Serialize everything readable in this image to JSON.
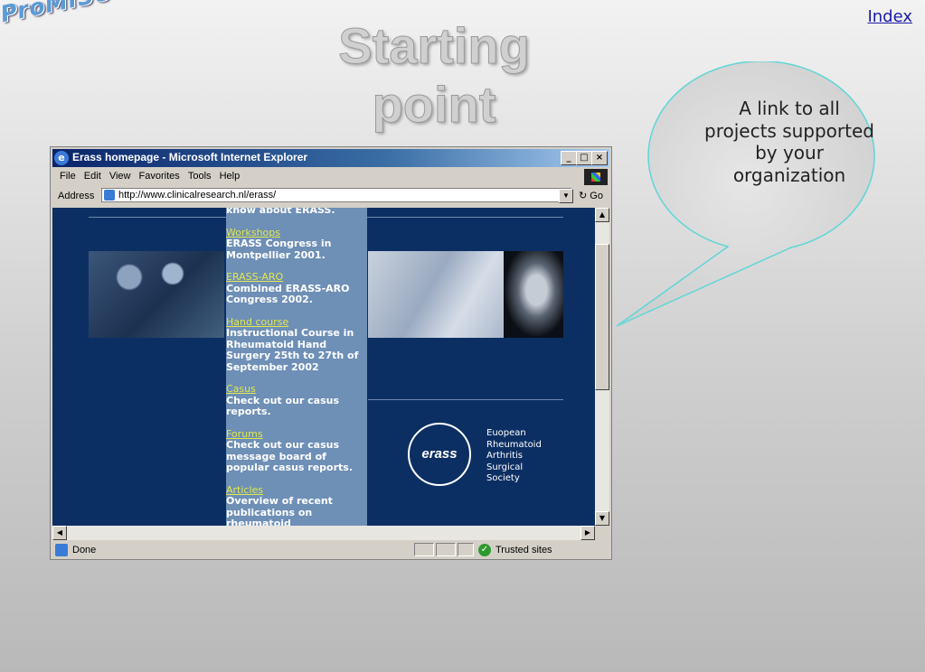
{
  "slide": {
    "logo": "ProMISe",
    "title": "Starting point",
    "index_link": "Index",
    "callout": "A link to all projects supported by your organization"
  },
  "browser": {
    "title": "Erass homepage - Microsoft Internet Explorer",
    "menu": [
      "File",
      "Edit",
      "View",
      "Favorites",
      "Tools",
      "Help"
    ],
    "address_label": "Address",
    "url": "http://www.clinicalresearch.nl/erass/",
    "go_label": "Go",
    "status": "Done",
    "zone": "Trusted sites"
  },
  "page": {
    "intro_tail": "know about ERASS.",
    "links": [
      {
        "label": "Workshops",
        "desc": "ERASS Congress in Montpellier 2001."
      },
      {
        "label": "ERASS-ARO",
        "desc": "Combined ERASS-ARO Congress 2002."
      },
      {
        "label": "Hand course",
        "desc": "Instructional Course in Rheumatoid Hand Surgery 25th to 27th of September 2002"
      },
      {
        "label": "Casus",
        "desc": "Check out our casus reports."
      },
      {
        "label": "Forums",
        "desc": "Check out our casus message board of popular casus reports."
      },
      {
        "label": "Articles",
        "desc": "Overview of recent publications on rheumatoid"
      }
    ],
    "logo_text": "erass",
    "society": [
      "Euopean",
      "Rheumatoid",
      "Arthritis",
      "Surgical",
      "Society"
    ]
  }
}
